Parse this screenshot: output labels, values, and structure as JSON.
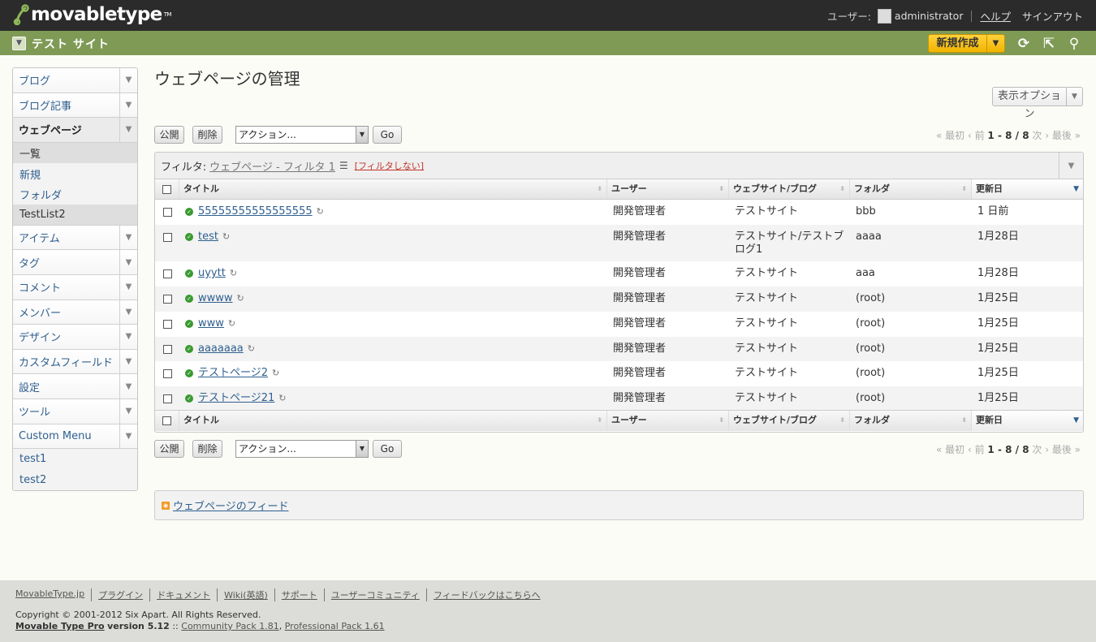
{
  "header": {
    "logo_text": "movabletype",
    "logo_tm": "TM",
    "user_label": "ユーザー:",
    "user_name": "administrator",
    "help": "ヘルプ",
    "signout": "サインアウト"
  },
  "sitebar": {
    "site_name": "テスト サイト",
    "new_button": "新規作成"
  },
  "sidebar": {
    "items": [
      {
        "label": "ブログ"
      },
      {
        "label": "ブログ記事"
      },
      {
        "label": "ウェブページ"
      },
      {
        "label": "アイテム"
      },
      {
        "label": "タグ"
      },
      {
        "label": "コメント"
      },
      {
        "label": "メンバー"
      },
      {
        "label": "デザイン"
      },
      {
        "label": "カスタムフィールド"
      },
      {
        "label": "設定"
      },
      {
        "label": "ツール"
      },
      {
        "label": "Custom Menu"
      }
    ],
    "webpage_sub": [
      "一覧",
      "新規",
      "フォルダ",
      "TestList2"
    ],
    "custom_sub": [
      "test1",
      "test2"
    ]
  },
  "main": {
    "title": "ウェブページの管理",
    "display_options": "表示オプション",
    "publish": "公開",
    "delete": "削除",
    "action_select": "アクション...",
    "go": "Go",
    "pager": {
      "first": "« 最初",
      "prev": "‹ 前",
      "range": "1 - 8 / 8",
      "next": "次 ›",
      "last": "最後 »"
    }
  },
  "filter": {
    "label": "フィルタ:",
    "name": "ウェブページ - フィルタ 1",
    "clear": "[フィルタしない]"
  },
  "columns": {
    "title": "タイトル",
    "user": "ユーザー",
    "site": "ウェブサイト/ブログ",
    "folder": "フォルダ",
    "date": "更新日"
  },
  "rows": [
    {
      "title": "55555555555555555",
      "user": "開発管理者",
      "site": "テストサイト",
      "folder": "bbb",
      "date": "1 日前"
    },
    {
      "title": "test",
      "user": "開発管理者",
      "site": "テストサイト/テストブログ1",
      "folder": "aaaa",
      "date": "1月28日"
    },
    {
      "title": "uyytt",
      "user": "開発管理者",
      "site": "テストサイト",
      "folder": "aaa",
      "date": "1月28日"
    },
    {
      "title": "wwww",
      "user": "開発管理者",
      "site": "テストサイト",
      "folder": "(root)",
      "date": "1月25日"
    },
    {
      "title": "www",
      "user": "開発管理者",
      "site": "テストサイト",
      "folder": "(root)",
      "date": "1月25日"
    },
    {
      "title": "aaaaaaa",
      "user": "開発管理者",
      "site": "テストサイト",
      "folder": "(root)",
      "date": "1月25日"
    },
    {
      "title": "テストページ2",
      "user": "開発管理者",
      "site": "テストサイト",
      "folder": "(root)",
      "date": "1月25日"
    },
    {
      "title": "テストページ21",
      "user": "開発管理者",
      "site": "テストサイト",
      "folder": "(root)",
      "date": "1月25日"
    }
  ],
  "feed": "ウェブページのフィード",
  "footer": {
    "links": [
      "MovableType.jp",
      "プラグイン",
      "ドキュメント",
      "Wiki(英語)",
      "サポート",
      "ユーザーコミュニティ",
      "フィードバックはこちらへ"
    ],
    "copyright": "Copyright © 2001-2012 Six Apart. All Rights Reserved.",
    "product": "Movable Type Pro",
    "version": "version 5.12",
    "sep": "::",
    "pack1": "Community Pack 1.81",
    "pack2": "Professional Pack 1.61"
  },
  "colors": {
    "header_bg": "#2b2b2b",
    "sitebar_bg": "#7e9a55",
    "new_button": "#f5c518",
    "link": "#2f5f8f",
    "status_published": "#3a9a32"
  }
}
